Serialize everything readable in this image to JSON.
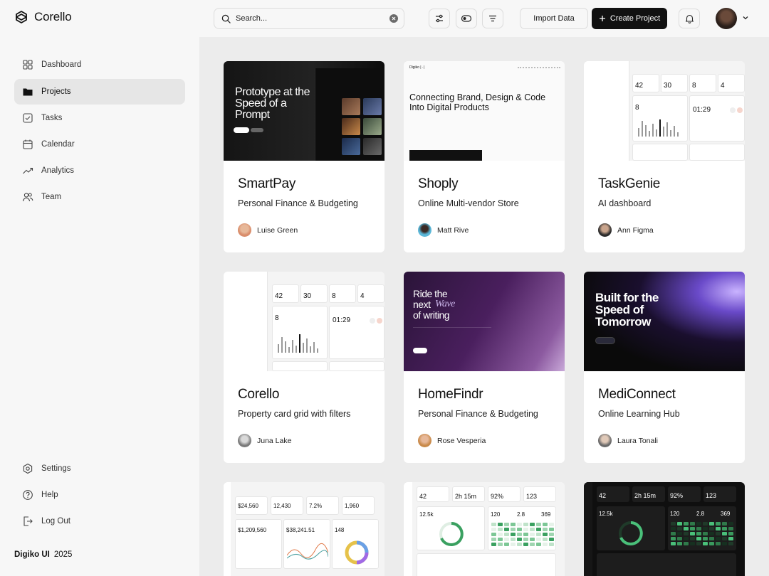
{
  "app": {
    "name": "Corello"
  },
  "search": {
    "placeholder": "Search..."
  },
  "toolbar": {
    "import_label": "Import Data",
    "create_label": "Create Project"
  },
  "sidebar": {
    "items": [
      {
        "label": "Dashboard",
        "icon": "grid-icon",
        "active": false
      },
      {
        "label": "Projects",
        "icon": "folder-icon",
        "active": true
      },
      {
        "label": "Tasks",
        "icon": "checkbox-icon",
        "active": false
      },
      {
        "label": "Calendar",
        "icon": "calendar-icon",
        "active": false
      },
      {
        "label": "Analytics",
        "icon": "trend-icon",
        "active": false
      },
      {
        "label": "Team",
        "icon": "users-icon",
        "active": false
      }
    ],
    "bottom_items": [
      {
        "label": "Settings",
        "icon": "settings-icon"
      },
      {
        "label": "Help",
        "icon": "help-icon"
      },
      {
        "label": "Log Out",
        "icon": "logout-icon"
      }
    ],
    "footer": {
      "brand": "Digiko UI",
      "year": "2025"
    }
  },
  "projects": [
    {
      "title": "SmartPay",
      "subtitle": "Personal Finance & Budgeting",
      "owner": "Luise Green",
      "thumb": {
        "headline": "Prototype at the Speed of a Prompt"
      }
    },
    {
      "title": "Shoply",
      "subtitle": "Online Multi-vendor Store",
      "owner": "Matt Rive",
      "thumb": {
        "brand": "Digiko | ·|",
        "headline": "Connecting Brand, Design & Code Into Digital Products"
      }
    },
    {
      "title": "TaskGenie",
      "subtitle": "AI dashboard",
      "owner": "Ann Figma",
      "thumb": {
        "stats": [
          "42",
          "30",
          "8",
          "4"
        ],
        "count": "8",
        "timer": "01:29"
      }
    },
    {
      "title": "Corello",
      "subtitle": "Property card grid with filters",
      "owner": "Juna Lake",
      "thumb": {
        "stats": [
          "42",
          "30",
          "8",
          "4"
        ],
        "count": "8",
        "timer": "01:29"
      }
    },
    {
      "title": "HomeFindr",
      "subtitle": "Personal Finance & Budgeting",
      "owner": "Rose Vesperia",
      "thumb": {
        "headline_1": "Ride the",
        "headline_2": "next",
        "headline_3": "Wave",
        "headline_4": "of writing"
      }
    },
    {
      "title": "MediConnect",
      "subtitle": "Online Learning Hub",
      "owner": "Laura Tonali",
      "thumb": {
        "headline": "Built for the Speed of Tomorrow"
      }
    },
    {
      "thumb": {
        "stats": [
          "$24,560",
          "12,430",
          "7.2%",
          "1,960"
        ],
        "big": [
          "$1,209,560",
          "$38,241.51",
          "148"
        ]
      }
    },
    {
      "thumb": {
        "stats": [
          "42",
          "2h 15m",
          "92%",
          "123"
        ],
        "mid": [
          "12.5k",
          "120",
          "2.8",
          "369"
        ]
      }
    },
    {
      "thumb": {
        "stats": [
          "42",
          "2h 15m",
          "92%",
          "123"
        ],
        "mid": [
          "12.5k",
          "120",
          "2.8",
          "369"
        ]
      }
    }
  ],
  "colors": {
    "accent": "#111111",
    "sidebar_active": "#e6e6e6",
    "background": "#ececec"
  }
}
